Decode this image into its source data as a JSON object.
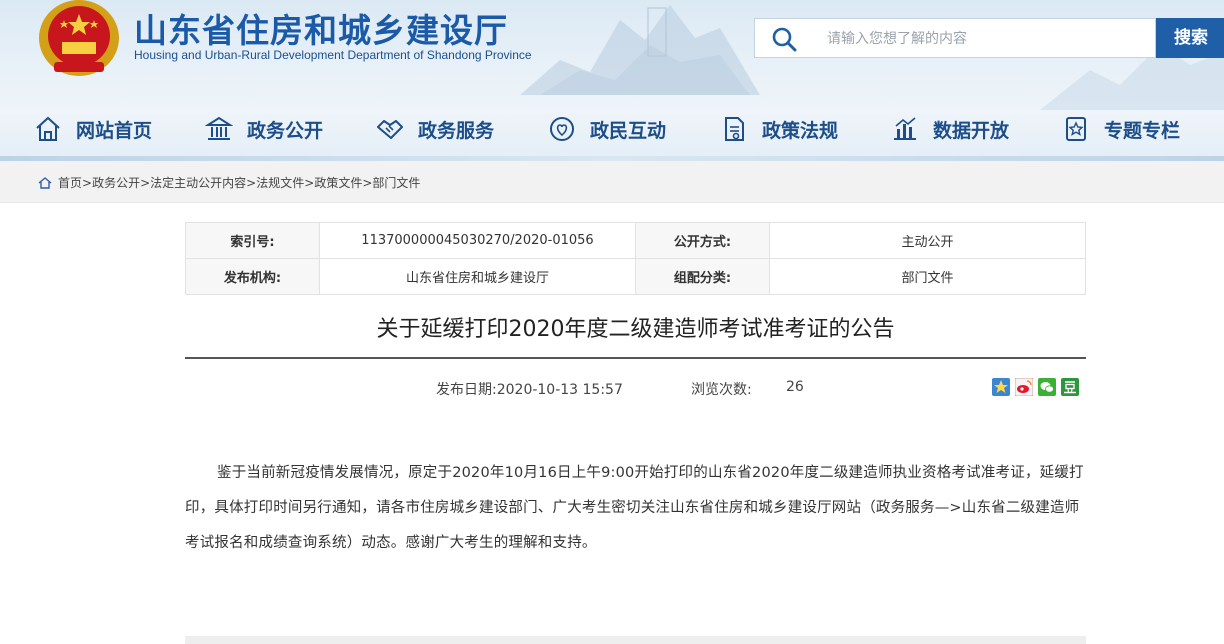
{
  "site": {
    "title": "山东省住房和城乡建设厅",
    "subtitle": "Housing and Urban-Rural Development Department of Shandong Province"
  },
  "search": {
    "placeholder": "请输入您想了解的内容",
    "button_label": "搜索"
  },
  "nav": {
    "items": [
      {
        "label": "网站首页",
        "icon": "home-icon"
      },
      {
        "label": "政务公开",
        "icon": "government-building-icon"
      },
      {
        "label": "政务服务",
        "icon": "handshake-icon"
      },
      {
        "label": "政民互动",
        "icon": "people-heart-icon"
      },
      {
        "label": "政策法规",
        "icon": "policy-document-icon"
      },
      {
        "label": "数据开放",
        "icon": "data-chart-icon"
      },
      {
        "label": "专题专栏",
        "icon": "topic-star-icon"
      }
    ]
  },
  "breadcrumb": {
    "items": [
      "首页",
      "政务公开",
      "法定主动公开内容",
      "法规文件",
      "政策文件",
      "部门文件"
    ],
    "separator": ">"
  },
  "info": {
    "index_no_label": "索引号:",
    "index_no": "113700000045030270/2020-01056",
    "disclosure_label": "公开方式:",
    "disclosure": "主动公开",
    "publisher_label": "发布机构:",
    "publisher": "山东省住房和城乡建设厅",
    "category_label": "组配分类:",
    "category": "部门文件"
  },
  "article": {
    "title": "关于延缓打印2020年度二级建造师考试准考证的公告",
    "publish_date": "发布日期:2020-10-13 15:57",
    "views_label": "浏览次数:",
    "views": "26",
    "body": "鉴于当前新冠疫情发展情况，原定于2020年10月16日上午9:00开始打印的山东省2020年度二级建造师执业资格考试准考证，延缓打印，具体打印时间另行通知，请各市住房城乡建设部门、广大考生密切关注山东省住房和城乡建设厅网站（政务服务—>山东省二级建造师考试报名和成绩查询系统）动态。感谢广大考生的理解和支持。"
  },
  "share": {
    "items": [
      "qzone-share-icon",
      "weibo-share-icon",
      "wechat-share-icon",
      "douban-share-icon"
    ]
  },
  "colors": {
    "brand_blue": "#1a5aa8",
    "search_button": "#1f5fa8",
    "nav_text": "#1d4e89"
  }
}
